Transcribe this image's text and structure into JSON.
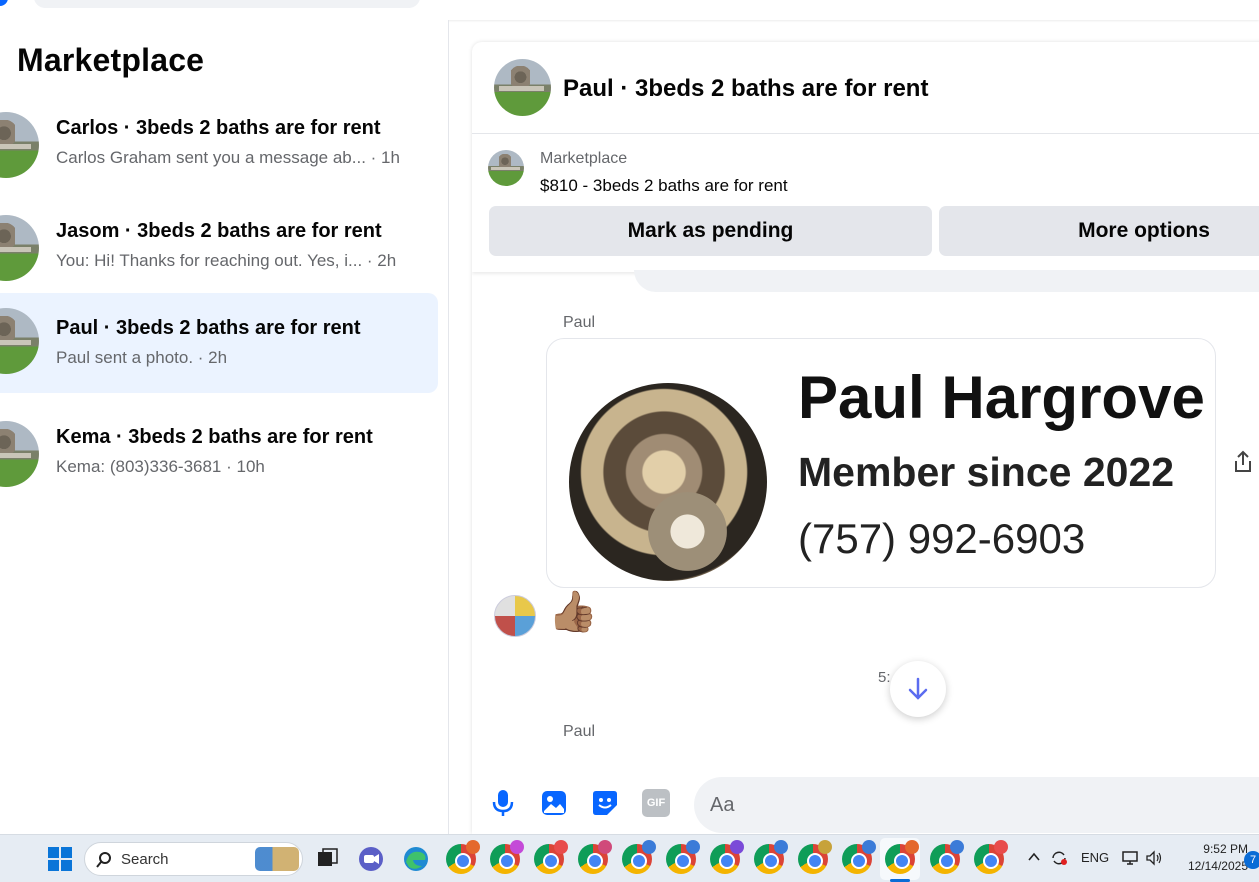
{
  "left_panel": {
    "title": "Marketplace",
    "conversations": [
      {
        "name": "Carlos · 3beds 2 baths are for rent",
        "preview": "Carlos Graham sent you a message ab... · 1h",
        "selected": false
      },
      {
        "name": "Jasom · 3beds 2 baths are for rent",
        "preview": "You: Hi! Thanks for reaching out. Yes, i... · 2h",
        "selected": false
      },
      {
        "name": "Paul · 3beds 2 baths are for rent",
        "preview": "Paul sent a photo. · 2h",
        "selected": true
      },
      {
        "name": "Kema · 3beds 2 baths are for rent",
        "preview": "Kema: (803)336-3681 · 10h",
        "selected": false
      }
    ]
  },
  "chat": {
    "header_title": "Paul · 3beds 2 baths are for rent",
    "marketplace_label": "Marketplace",
    "listing": "$810 - 3beds 2 baths are for rent",
    "mark_pending_button": "Mark as pending",
    "more_options_button": "More options",
    "sender_top": "Paul",
    "photo_card": {
      "name": "Paul Hargrove",
      "member_since": "Member since 2022",
      "phone": "(757) 992-6903"
    },
    "reaction": "👍🏽",
    "timestamp_partial": "5:",
    "sender_bottom": "Paul",
    "composer_placeholder": "Aa",
    "composer_gif": "GIF",
    "accent": "#0866ff"
  },
  "taskbar": {
    "search_label": "Search",
    "language": "ENG",
    "time": "9:52 PM",
    "date": "12/14/2025",
    "notifications": "7"
  }
}
